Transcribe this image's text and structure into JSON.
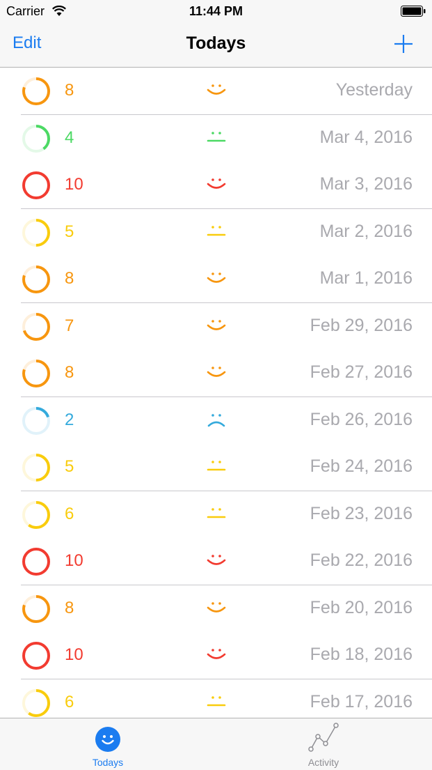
{
  "status_bar": {
    "carrier": "Carrier",
    "time": "11:44 PM"
  },
  "nav": {
    "edit_label": "Edit",
    "title": "Todays",
    "add_icon": "plus-icon"
  },
  "colors": {
    "accent": "#1b7cf0",
    "orange": "#f7960f",
    "green": "#4cd964",
    "red": "#f23b30",
    "yellow": "#f9cc0d",
    "blue": "#34aadc",
    "date_gray": "#a9a9ae"
  },
  "entries": [
    {
      "value": "8",
      "date": "Yesterday",
      "mood": "happy",
      "color": "orange",
      "level": 0.8
    },
    {
      "value": "4",
      "date": "Mar 4, 2016",
      "mood": "neutral",
      "color": "green",
      "level": 0.4
    },
    {
      "value": "10",
      "date": "Mar 3, 2016",
      "mood": "happy",
      "color": "red",
      "level": 1.0
    },
    {
      "value": "5",
      "date": "Mar 2, 2016",
      "mood": "neutral",
      "color": "yellow",
      "level": 0.5
    },
    {
      "value": "8",
      "date": "Mar 1, 2016",
      "mood": "happy",
      "color": "orange",
      "level": 0.8
    },
    {
      "value": "7",
      "date": "Feb 29, 2016",
      "mood": "happy",
      "color": "orange",
      "level": 0.7
    },
    {
      "value": "8",
      "date": "Feb 27, 2016",
      "mood": "happy",
      "color": "orange",
      "level": 0.8
    },
    {
      "value": "2",
      "date": "Feb 26, 2016",
      "mood": "sad",
      "color": "blue",
      "level": 0.2
    },
    {
      "value": "5",
      "date": "Feb 24, 2016",
      "mood": "neutral",
      "color": "yellow",
      "level": 0.5
    },
    {
      "value": "6",
      "date": "Feb 23, 2016",
      "mood": "neutral",
      "color": "yellow",
      "level": 0.6
    },
    {
      "value": "10",
      "date": "Feb 22, 2016",
      "mood": "happy",
      "color": "red",
      "level": 1.0
    },
    {
      "value": "8",
      "date": "Feb 20, 2016",
      "mood": "happy",
      "color": "orange",
      "level": 0.8
    },
    {
      "value": "10",
      "date": "Feb 18, 2016",
      "mood": "happy",
      "color": "red",
      "level": 1.0
    },
    {
      "value": "6",
      "date": "Feb 17, 2016",
      "mood": "neutral",
      "color": "yellow",
      "level": 0.6
    }
  ],
  "tabs": [
    {
      "label": "Todays",
      "icon": "smiley-icon",
      "active": true
    },
    {
      "label": "Activity",
      "icon": "activity-chart-icon",
      "active": false
    }
  ]
}
